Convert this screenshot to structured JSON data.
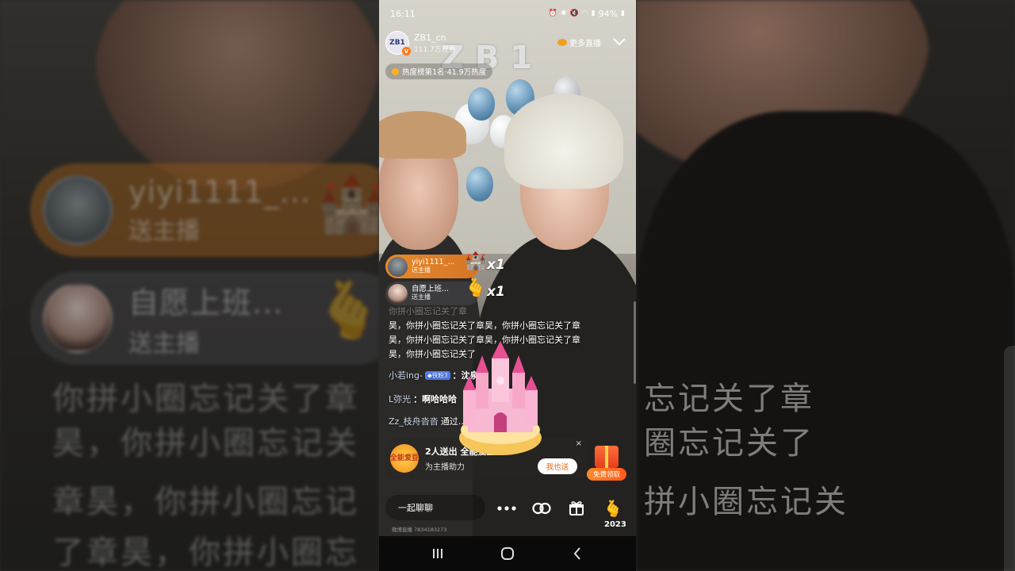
{
  "status": {
    "time": "16:11",
    "battery": "94%"
  },
  "host": {
    "avatar_text": "ZB1",
    "name": "ZB1_cn",
    "viewers": "111.7万观看"
  },
  "header": {
    "more_live": "更多直播",
    "hot_rank": "热度榜第1名·41.9万热度"
  },
  "wall_letters": "ZB1",
  "gifts": [
    {
      "name": "yiyi1111_...",
      "action": "送主播",
      "count": "x1",
      "gift_icon": "castle-icon"
    },
    {
      "name": "自愿上班...",
      "action": "送主播",
      "count": "x1",
      "gift_icon": "finger-heart-icon"
    }
  ],
  "comments": {
    "faded_line": "你拼小圈忘记关了章",
    "block": "昊，你拼小圈忘记关了章昊，你拼小圈忘记关了章昊，你拼小圈忘记关了章昊，你拼小圈忘记关了章昊，你拼小圈忘记关了",
    "line1": {
      "user": "小若ing-",
      "badge": "◆铁粉3",
      "text": "：沈泉锐"
    },
    "line2": {
      "user": "L弥光",
      "text": "：啊哈哈哈"
    },
    "line3": {
      "user": "Zz_枝舟沓沓",
      "text": "通过…直播间"
    }
  },
  "support": {
    "icon_text": "全能爱豆",
    "title": "2人送出 全能爱豆",
    "subtitle": "为主播助力",
    "button": "我也送",
    "close": "×"
  },
  "free_gift": {
    "label": "免费领取"
  },
  "bottom": {
    "chat_placeholder": "一起聊聊",
    "year": "2023",
    "room_id": "微博直播 7834183273"
  },
  "background": {
    "left_name": "yiyi1111_...",
    "left_action": "送主播",
    "left_name2": "自愿上班...",
    "left_action2": "送主播",
    "left_lines": [
      "你拼小圈忘记关了章",
      "昊，你拼小圈忘记关",
      "章昊，你拼小圈忘记",
      "了章昊，你拼小圈忘"
    ],
    "right_lines": [
      "忘记关了章",
      "圈忘记关了",
      "拼小圈忘记关"
    ]
  },
  "colors": {
    "accent_orange": "#e88a2b",
    "fan_badge": "#4f7df0",
    "support_button_text": "#e06a1a"
  }
}
